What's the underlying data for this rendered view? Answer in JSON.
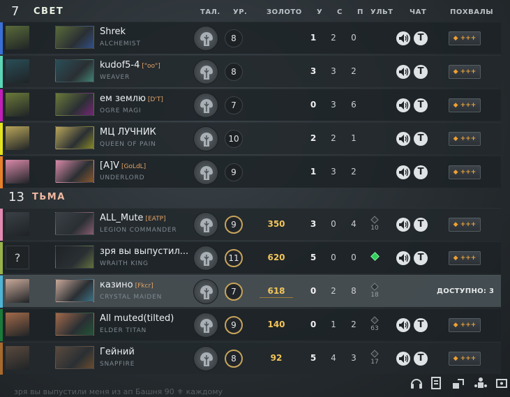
{
  "columns": {
    "talents": "ТАЛ.",
    "level": "УР.",
    "gold": "ЗОЛОТО",
    "kills": "У",
    "deaths": "С",
    "assists": "П",
    "ult": "УЛЬТ",
    "chat": "ЧАТ",
    "praise": "ПОХВАЛЫ"
  },
  "radiant": {
    "score": "7",
    "name": "СВЕТ"
  },
  "dire": {
    "score": "13",
    "name": "ТЬМА"
  },
  "players": [
    {
      "name": "Shrek",
      "tag": "",
      "hero": "ALCHEMIST",
      "level": "8",
      "gold": "",
      "k": "1",
      "d": "2",
      "a": "0",
      "ult": "",
      "slot_color": "#3b6fd8",
      "avatar_color": "#5a6b3a"
    },
    {
      "name": "kudof5-4",
      "tag": "[\"oo\"]",
      "hero": "WEAVER",
      "level": "8",
      "gold": "",
      "k": "3",
      "d": "3",
      "a": "2",
      "ult": "",
      "slot_color": "#5bd7b7",
      "avatar_color": "#2a4e57"
    },
    {
      "name": "ем землю",
      "tag": "[D'T]",
      "hero": "OGRE MAGI",
      "level": "7",
      "gold": "",
      "k": "0",
      "d": "3",
      "a": "6",
      "ult": "",
      "slot_color": "#c01fb8",
      "avatar_color": "#6b7a3a"
    },
    {
      "name": "МЦ ЛУЧНИК",
      "tag": "",
      "hero": "QUEEN OF PAIN",
      "level": "10",
      "gold": "",
      "k": "2",
      "d": "2",
      "a": "1",
      "ult": "",
      "slot_color": "#e4e31e",
      "avatar_color": "#b9a65a"
    },
    {
      "name": "[A]V",
      "tag": "[GoLdL]",
      "hero": "UNDERLORD",
      "level": "9",
      "gold": "",
      "k": "1",
      "d": "3",
      "a": "2",
      "ult": "",
      "slot_color": "#e8802a",
      "avatar_color": "#d98aa8"
    },
    {
      "name": "ALL_Mute",
      "tag": "[EATP]",
      "hero": "LEGION COMMANDER",
      "level": "9",
      "gold": "350",
      "k": "3",
      "d": "0",
      "a": "4",
      "ult": "10",
      "slot_color": "#e48ab2",
      "avatar_color": "#3a4046"
    },
    {
      "name": "зря вы выпустил...",
      "tag": "",
      "hero": "WRAITH KING",
      "level": "11",
      "gold": "620",
      "k": "5",
      "d": "0",
      "a": "0",
      "ult": "ready",
      "slot_color": "#9ab24a",
      "avatar_color": "#1f2326"
    },
    {
      "name": "казино",
      "tag": "[Fkcr]",
      "hero": "CRYSTAL MAIDEN",
      "level": "7",
      "gold": "618",
      "k": "0",
      "d": "2",
      "a": "8",
      "ult": "18",
      "slot_color": "#4fb5d6",
      "avatar_color": "#c9a99a"
    },
    {
      "name": "All muted(tilted)",
      "tag": "",
      "hero": "ELDER TITAN",
      "level": "9",
      "gold": "140",
      "k": "0",
      "d": "1",
      "a": "2",
      "ult": "63",
      "slot_color": "#1a7a3a",
      "avatar_color": "#a26a4a"
    },
    {
      "name": "Гейний",
      "tag": "",
      "hero": "SNAPFIRE",
      "level": "8",
      "gold": "92",
      "k": "5",
      "d": "4",
      "a": "3",
      "ult": "17",
      "slot_color": "#a8692c",
      "avatar_color": "#5a4a3e"
    }
  ],
  "avatars": {
    "unknown": "?"
  },
  "self_row": {
    "available_text": "ДОСТУПНО: 3"
  },
  "praise_label": "+++",
  "chat": {
    "text_icon": "T"
  },
  "bottom": {
    "feed_text": "зря вы выпустили меня из ап    Башня 90 ⚜ каждому"
  },
  "icons": [
    "mute-icon",
    "text-chat-icon",
    "praise-icon",
    "headset-icon",
    "report-icon",
    "share-icon",
    "coach-icon",
    "settings-icon"
  ]
}
